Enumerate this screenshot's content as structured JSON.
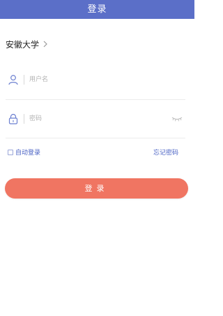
{
  "header": {
    "title": "登录"
  },
  "school": {
    "name": "安徽大学",
    "chevron_icon": "chevron-right-icon"
  },
  "username": {
    "placeholder": "用户名",
    "value": "",
    "icon": "user-icon"
  },
  "password": {
    "placeholder": "密码",
    "value": "",
    "icon": "lock-icon",
    "toggle_icon": "eye-closed-icon"
  },
  "options": {
    "remember_label": "自动登录",
    "remember_checked": false,
    "forgot_label": "忘记密码"
  },
  "login_button": {
    "label": "登录"
  },
  "colors": {
    "header_bg": "#5b6fc8",
    "accent": "#4a62c4",
    "button_bg": "#f07562"
  }
}
